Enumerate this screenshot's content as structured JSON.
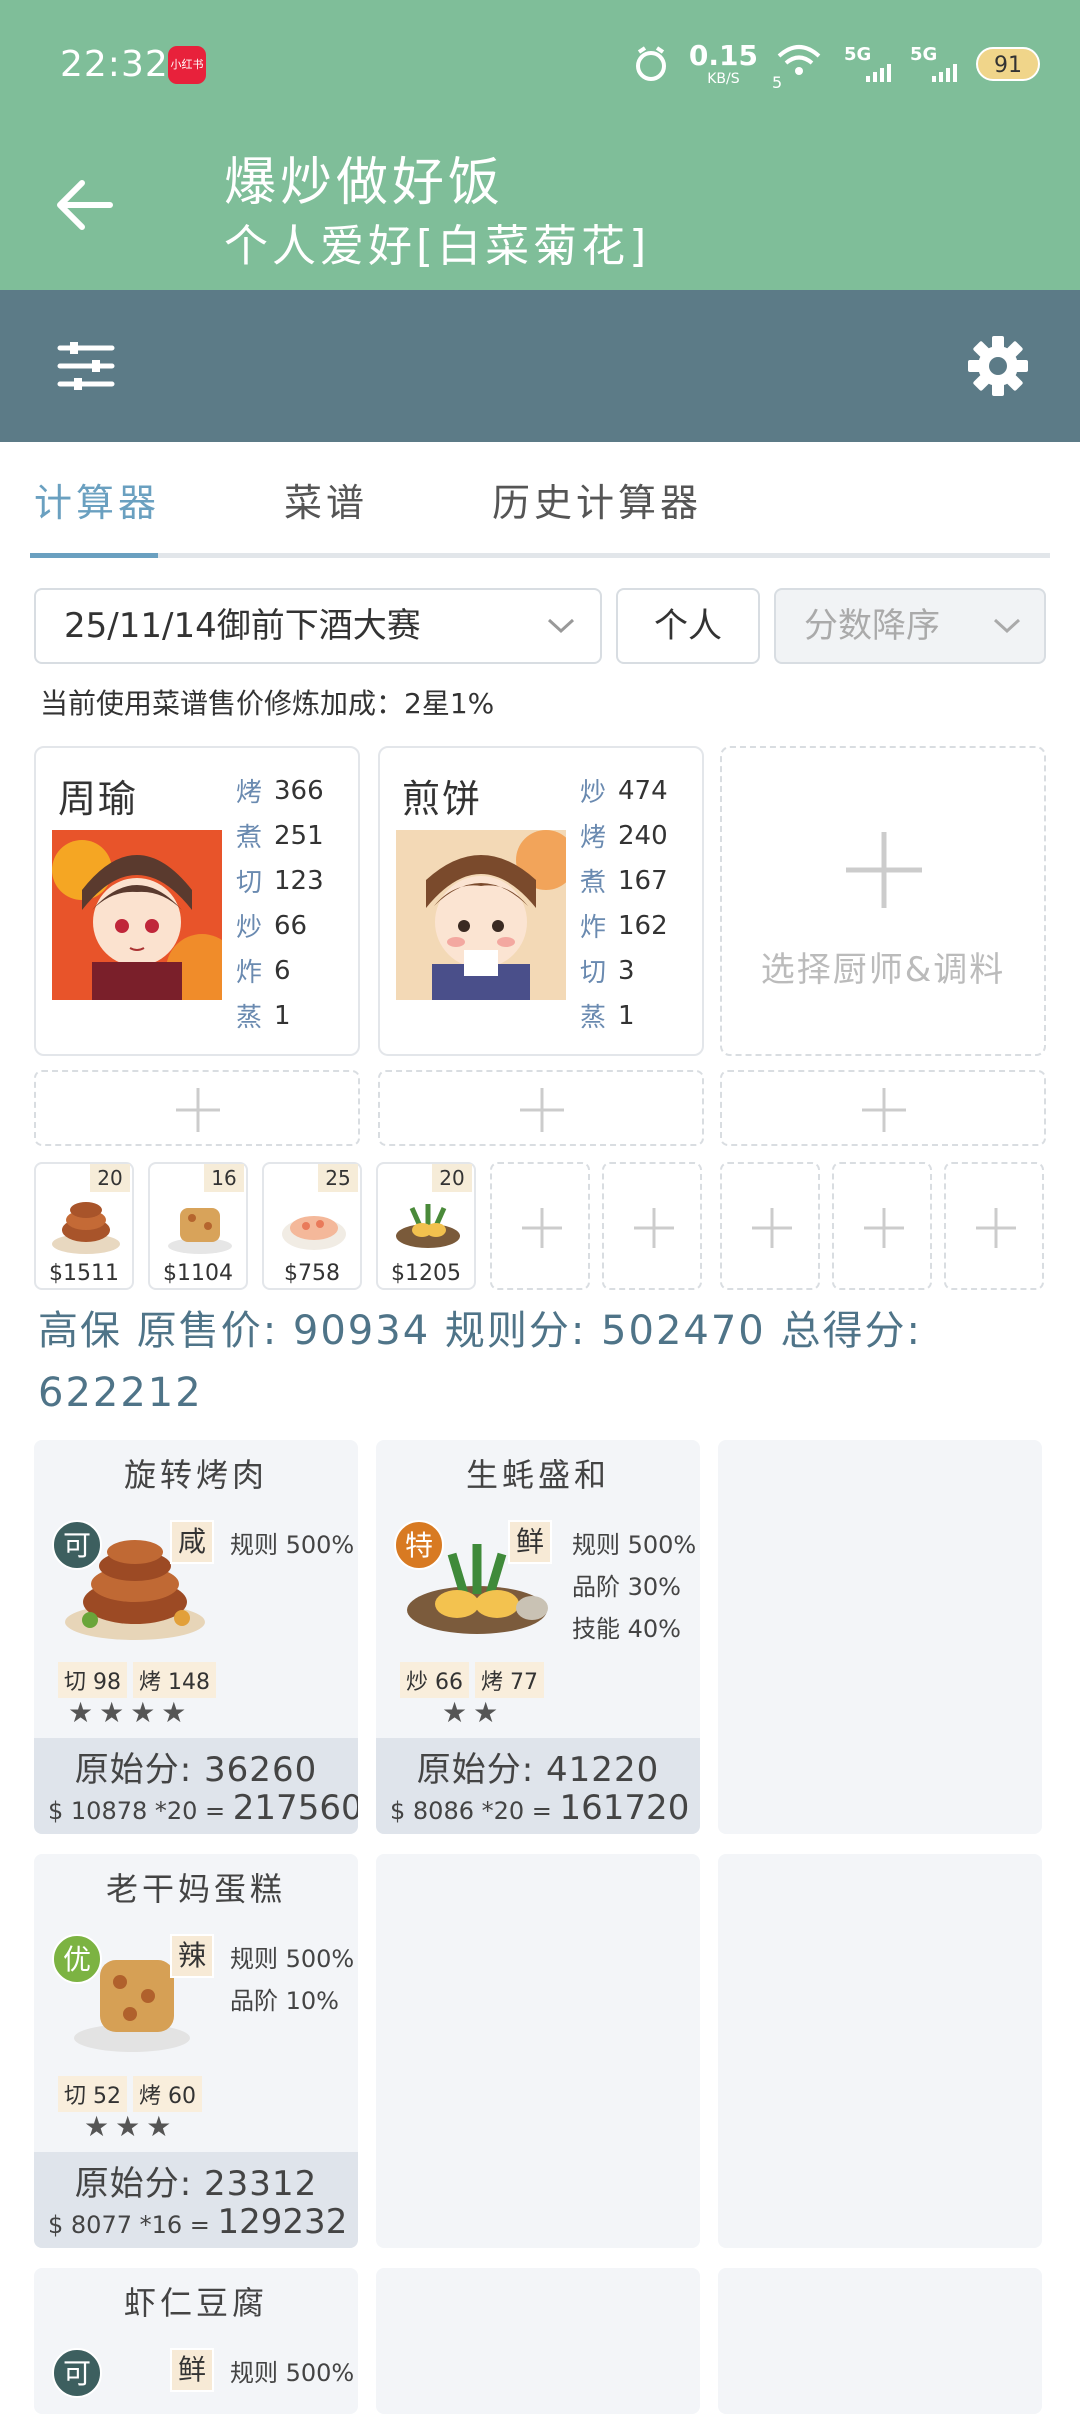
{
  "status": {
    "time": "22:32",
    "app_icon_label": "小红书",
    "net_speed": "0.15",
    "net_unit": "KB/S",
    "wifi_sub": "5",
    "signal1": "5G",
    "signal2": "5G",
    "battery": "91"
  },
  "header": {
    "title": "爆炒做好饭",
    "subtitle": "个人爱好[白菜菊花]"
  },
  "tabs": [
    "计算器",
    "菜谱",
    "历史计算器"
  ],
  "selectors": {
    "contest": "25/11/14御前下酒大赛",
    "mode": "个人",
    "sort": "分数降序"
  },
  "bonus_line": "当前使用菜谱售价修炼加成：2星1%",
  "chefs": [
    {
      "name": "周瑜",
      "stats": [
        {
          "k": "烤",
          "v": "366"
        },
        {
          "k": "煮",
          "v": "251"
        },
        {
          "k": "切",
          "v": "123"
        },
        {
          "k": "炒",
          "v": "66"
        },
        {
          "k": "炸",
          "v": "6"
        },
        {
          "k": "蒸",
          "v": "1"
        }
      ]
    },
    {
      "name": "煎饼",
      "stats": [
        {
          "k": "炒",
          "v": "474"
        },
        {
          "k": "烤",
          "v": "240"
        },
        {
          "k": "煮",
          "v": "167"
        },
        {
          "k": "炸",
          "v": "162"
        },
        {
          "k": "切",
          "v": "3"
        },
        {
          "k": "蒸",
          "v": "1"
        }
      ]
    }
  ],
  "empty_chef_label": "选择厨师&调料",
  "dishes": [
    {
      "qty": "20",
      "price": "$1511"
    },
    {
      "qty": "16",
      "price": "$1104"
    },
    {
      "qty": "25",
      "price": "$758"
    },
    {
      "qty": "20",
      "price": "$1205"
    }
  ],
  "score_line": "高保 原售价: 90934 规则分: 502470 总得分: 622212",
  "results": [
    {
      "name": "旋转烤肉",
      "badge": "可",
      "badge_color": "#3d5f5f",
      "flavor": "咸",
      "rules": [
        "规则 500%"
      ],
      "req": [
        "切 98",
        "烤 148"
      ],
      "stars": "★★★★",
      "orig": "原始分: 36260",
      "calc": "$ 10878 *20 =",
      "total": "217560"
    },
    {
      "name": "生蚝盛和",
      "badge": "特",
      "badge_color": "#d87a22",
      "flavor": "鲜",
      "rules": [
        "规则 500%",
        "品阶 30%",
        "技能 40%"
      ],
      "req": [
        "炒 66",
        "烤 77"
      ],
      "stars": "★★",
      "orig": "原始分: 41220",
      "calc": "$ 8086 *20 =",
      "total": "161720"
    },
    {
      "name": "老干妈蛋糕",
      "badge": "优",
      "badge_color": "#7cb342",
      "flavor": "辣",
      "rules": [
        "规则 500%",
        "品阶 10%"
      ],
      "req": [
        "切 52",
        "烤 60"
      ],
      "stars": "★★★",
      "orig": "原始分: 23312",
      "calc": "$ 8077 *16 =",
      "total": "129232"
    },
    {
      "name": "虾仁豆腐",
      "badge": "可",
      "badge_color": "#3d5f5f",
      "flavor": "鲜",
      "rules": [
        "规则 500%"
      ]
    }
  ],
  "colors": {
    "header_green": "#7fbe99",
    "toolbar_slate": "#5c7b87",
    "accent_blue": "#6aa0c0"
  }
}
